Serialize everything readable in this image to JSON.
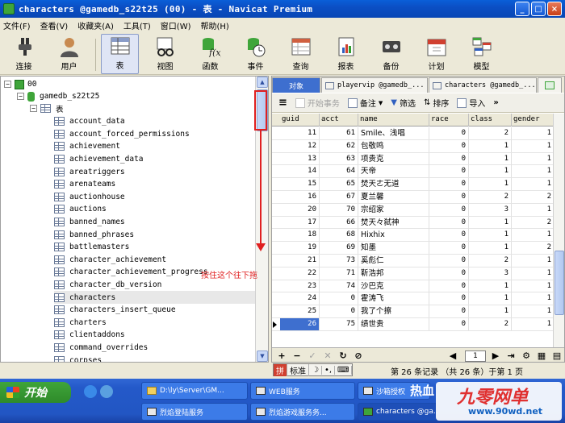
{
  "window": {
    "title": "characters @gamedb_s22t25 (00) - 表 - Navicat Premium",
    "buttons": [
      "_",
      "□",
      "×"
    ]
  },
  "menu": [
    "文件(F)",
    "查看(V)",
    "收藏夹(A)",
    "工具(T)",
    "窗口(W)",
    "帮助(H)"
  ],
  "toolbar": [
    {
      "label": "连接",
      "icon": "connection-icon"
    },
    {
      "label": "用户",
      "icon": "user-icon"
    },
    {
      "label": "表",
      "icon": "table-icon",
      "active": true
    },
    {
      "label": "视图",
      "icon": "view-icon"
    },
    {
      "label": "函数",
      "icon": "function-icon"
    },
    {
      "label": "事件",
      "icon": "event-icon"
    },
    {
      "label": "查询",
      "icon": "query-icon"
    },
    {
      "label": "报表",
      "icon": "report-icon"
    },
    {
      "label": "备份",
      "icon": "backup-icon"
    },
    {
      "label": "计划",
      "icon": "schedule-icon"
    },
    {
      "label": "模型",
      "icon": "model-icon"
    }
  ],
  "tree": {
    "connection": "00",
    "database": "gamedb_s22t25",
    "tables_node": "表",
    "tables": [
      "account_data",
      "account_forced_permissions",
      "achievement",
      "achievement_data",
      "areatriggers",
      "arenateams",
      "auctionhouse",
      "auctions",
      "banned_names",
      "banned_phrases",
      "battlemasters",
      "character_achievement",
      "character_achievement_progress",
      "character_db_version",
      "characters",
      "characters_insert_queue",
      "charters",
      "clientaddons",
      "command_overrides",
      "corpses"
    ],
    "selected": "characters"
  },
  "annotation": "按住这个往下拖",
  "tabs": [
    {
      "label": "对象"
    },
    {
      "label": "playervip @gamedb_..."
    },
    {
      "label": "characters @gamedb_..."
    }
  ],
  "obj_toolbar": {
    "begin_transaction": "开始事务",
    "memo": "备注",
    "filter": "筛选",
    "sort": "排序",
    "import": "导入"
  },
  "grid": {
    "columns": [
      "guid",
      "acct",
      "name",
      "race",
      "class",
      "gender"
    ],
    "rows": [
      {
        "guid": "11",
        "acct": "61",
        "name": "Smile、浅唱",
        "race": "0",
        "class": "2",
        "gender": "1"
      },
      {
        "guid": "12",
        "acct": "62",
        "name": "包敬鸣",
        "race": "0",
        "class": "1",
        "gender": "1"
      },
      {
        "guid": "13",
        "acct": "63",
        "name": "项贵克",
        "race": "0",
        "class": "1",
        "gender": "1"
      },
      {
        "guid": "14",
        "acct": "64",
        "name": "天帝",
        "race": "0",
        "class": "1",
        "gender": "1"
      },
      {
        "guid": "15",
        "acct": "65",
        "name": "焚天ㄜ无道",
        "race": "0",
        "class": "1",
        "gender": "1"
      },
      {
        "guid": "16",
        "acct": "67",
        "name": "夏兰馨",
        "race": "0",
        "class": "2",
        "gender": "2"
      },
      {
        "guid": "20",
        "acct": "70",
        "name": "宗绍家",
        "race": "0",
        "class": "3",
        "gender": "1"
      },
      {
        "guid": "17",
        "acct": "66",
        "name": "焚天々弑神",
        "race": "0",
        "class": "1",
        "gender": "2"
      },
      {
        "guid": "18",
        "acct": "68",
        "name": "Hixhix",
        "race": "0",
        "class": "1",
        "gender": "1"
      },
      {
        "guid": "19",
        "acct": "69",
        "name": "知墨",
        "race": "0",
        "class": "1",
        "gender": "2"
      },
      {
        "guid": "21",
        "acct": "73",
        "name": "奚彪仁",
        "race": "0",
        "class": "2",
        "gender": "1"
      },
      {
        "guid": "22",
        "acct": "71",
        "name": "靳浩邦",
        "race": "0",
        "class": "3",
        "gender": "1"
      },
      {
        "guid": "23",
        "acct": "74",
        "name": "沙巴克",
        "race": "0",
        "class": "1",
        "gender": "1"
      },
      {
        "guid": "24",
        "acct": "0",
        "name": "霍涛飞",
        "race": "0",
        "class": "1",
        "gender": "1"
      },
      {
        "guid": "25",
        "acct": "0",
        "name": "我了个擦",
        "race": "0",
        "class": "1",
        "gender": "1"
      },
      {
        "guid": "26",
        "acct": "75",
        "name": "绩世贵",
        "race": "0",
        "class": "2",
        "gender": "1"
      }
    ],
    "current_row": "26"
  },
  "nav": {
    "page": "1"
  },
  "ime": {
    "mode": "标准"
  },
  "status": "第 26 条记录 （共 26 条）于第 1 页",
  "taskbar": {
    "start": "开始",
    "tasks": [
      {
        "label": "D:\\ly\\Server\\GM...",
        "icon": "folder"
      },
      {
        "label": "WEB服务",
        "icon": "console"
      },
      {
        "label": "沙箱授权",
        "icon": "console"
      },
      {
        "label": "烈焰登陆服务",
        "icon": "console"
      },
      {
        "label": "烈焰游戏服务务...",
        "icon": "console"
      },
      {
        "label": "characters @ga...",
        "icon": "app"
      }
    ]
  },
  "watermark": {
    "brand": "九零网单",
    "url": "www.90wd.net",
    "heat": "热血"
  }
}
